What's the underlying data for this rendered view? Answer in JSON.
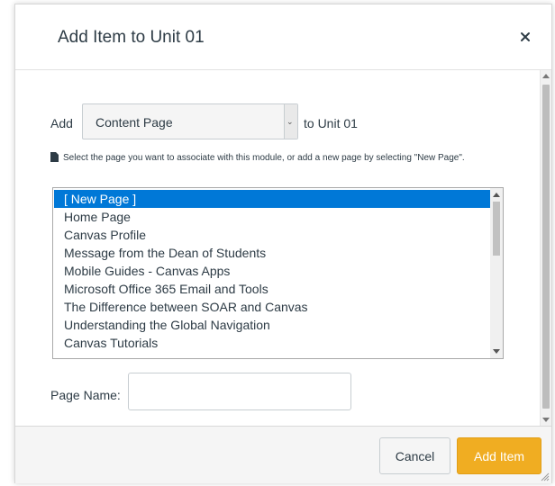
{
  "dialog": {
    "title": "Add Item to Unit 01",
    "close_icon": "close-icon"
  },
  "form": {
    "add_label": "Add",
    "item_type": {
      "selected": "Content Page",
      "icon": "chevron-down-icon"
    },
    "to_unit_label": "to Unit 01",
    "hint": {
      "icon": "document-icon",
      "text": "Select the page you want to associate with this module, or add a new page by selecting \"New Page\"."
    },
    "pages": [
      {
        "label": "[ New Page ]",
        "selected": true
      },
      {
        "label": "Home Page",
        "selected": false
      },
      {
        "label": "Canvas Profile",
        "selected": false
      },
      {
        "label": "Message from the Dean of Students",
        "selected": false
      },
      {
        "label": "Mobile Guides - Canvas Apps",
        "selected": false
      },
      {
        "label": "Microsoft Office 365 Email and Tools",
        "selected": false
      },
      {
        "label": "The Difference between SOAR and Canvas",
        "selected": false
      },
      {
        "label": "Understanding the Global Navigation",
        "selected": false
      },
      {
        "label": "Canvas Tutorials",
        "selected": false
      }
    ],
    "page_name_label": "Page Name:",
    "page_name_value": ""
  },
  "footer": {
    "cancel_label": "Cancel",
    "add_item_label": "Add Item"
  },
  "colors": {
    "selection": "#0078d7",
    "primary_button": "#f0ad22",
    "text": "#2d3b45"
  }
}
